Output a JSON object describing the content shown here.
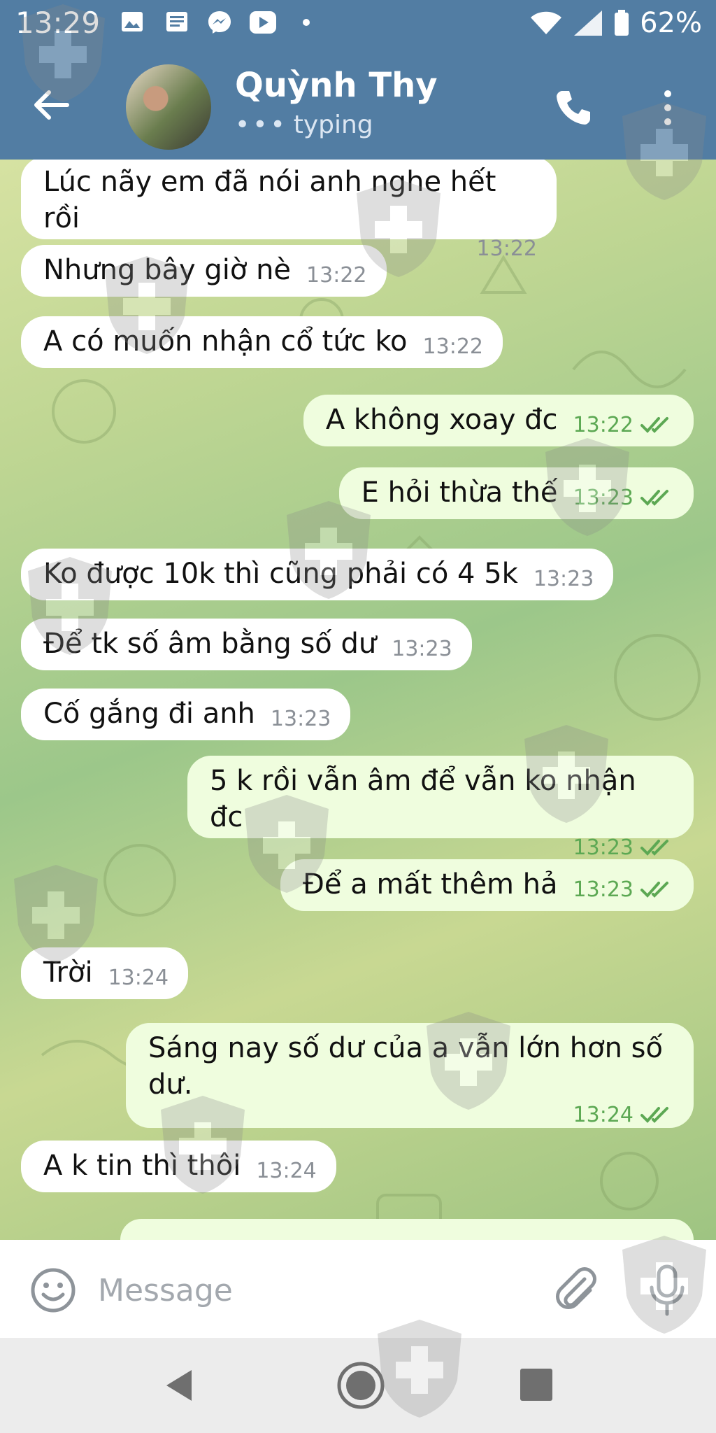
{
  "status_bar": {
    "time": "13:29",
    "notification_icons": [
      "gallery-icon",
      "news-icon",
      "messenger-icon",
      "youtube-icon",
      "dot-icon"
    ],
    "battery": "62%"
  },
  "header": {
    "contact_name": "Quỳnh Thy",
    "status": "typing",
    "status_dots": "•••"
  },
  "messages": [
    {
      "direction": "in",
      "text": "Lúc nãy em đã nói anh nghe hết rồi",
      "time": "13:22"
    },
    {
      "direction": "in",
      "text": "Nhưng bây giờ nè",
      "time": "13:22"
    },
    {
      "direction": "in",
      "text": "A có muốn nhận cổ tức ko",
      "time": "13:22"
    },
    {
      "direction": "out",
      "text": "A không xoay đc",
      "time": "13:22",
      "read": true
    },
    {
      "direction": "out",
      "text": "E hỏi thừa thế",
      "time": "13:23",
      "read": true
    },
    {
      "direction": "in",
      "text": "Ko được 10k thì cũng phải có 4 5k",
      "time": "13:23"
    },
    {
      "direction": "in",
      "text": "Để tk số âm bằng số dư",
      "time": "13:23"
    },
    {
      "direction": "in",
      "text": "Cố gắng đi anh",
      "time": "13:23"
    },
    {
      "direction": "out",
      "text": "5 k rồi vẫn âm để vẫn ko nhận đc",
      "time": "13:23",
      "read": true
    },
    {
      "direction": "out",
      "text": "Để a mất thêm hả",
      "time": "13:23",
      "read": true
    },
    {
      "direction": "in",
      "text": "Trời",
      "time": "13:24"
    },
    {
      "direction": "out",
      "text": "Sáng nay số dư của a vẫn lớn hơn số dư.",
      "time": "13:24",
      "read": true
    },
    {
      "direction": "in",
      "text": "A k tin thì thôi",
      "time": "13:24"
    }
  ],
  "input": {
    "placeholder": "Message",
    "value": ""
  },
  "colors": {
    "header_bg": "#527da3",
    "incoming_bubble": "#ffffff",
    "outgoing_bubble": "#effdde",
    "outgoing_meta": "#5ca853",
    "incoming_meta": "#8a8f96"
  },
  "icons": {
    "back": "arrow-left-icon",
    "call": "phone-icon",
    "menu": "more-vertical-icon",
    "emoji": "smiley-icon",
    "attach": "paperclip-icon",
    "mic": "microphone-icon"
  }
}
